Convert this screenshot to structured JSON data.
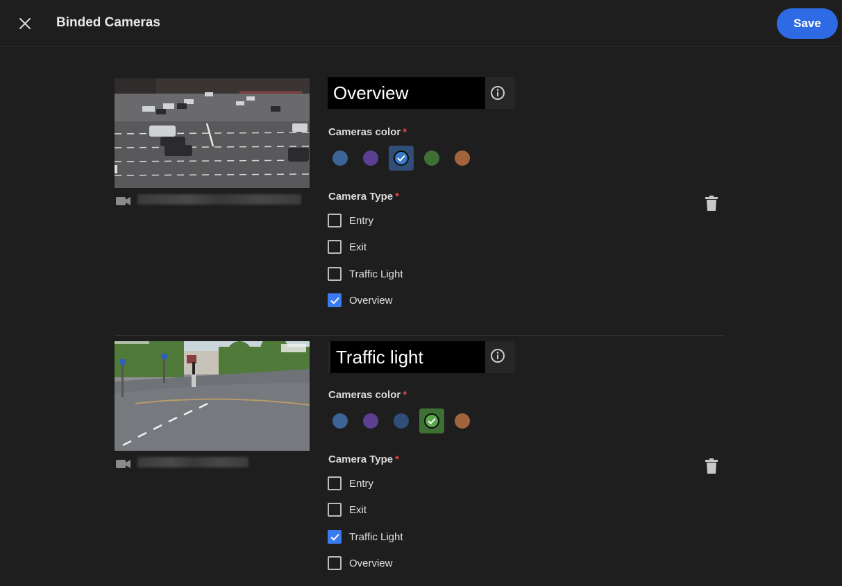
{
  "header": {
    "title": "Binded Cameras",
    "save_label": "Save"
  },
  "cameras": [
    {
      "name": "Overview",
      "color_label": "Cameras color",
      "type_label": "Camera Type",
      "required_mark": "*",
      "colors": [
        "#3d6496",
        "#5b3f91",
        "#3b7bc9",
        "#3f6e37",
        "#a4643b"
      ],
      "selected_color_index": 2,
      "types": [
        {
          "label": "Entry",
          "checked": false
        },
        {
          "label": "Exit",
          "checked": false
        },
        {
          "label": "Traffic Light",
          "checked": false
        },
        {
          "label": "Overview",
          "checked": true
        }
      ]
    },
    {
      "name": "Traffic light",
      "color_label": "Cameras color",
      "type_label": "Camera Type",
      "required_mark": "*",
      "colors": [
        "#3d6496",
        "#5b3f91",
        "#2f4f78",
        "#5aa84a",
        "#a4643b"
      ],
      "selected_color_index": 3,
      "types": [
        {
          "label": "Entry",
          "checked": false
        },
        {
          "label": "Exit",
          "checked": false
        },
        {
          "label": "Traffic Light",
          "checked": true
        },
        {
          "label": "Overview",
          "checked": false
        }
      ]
    }
  ],
  "icons": {
    "close": "close-icon",
    "info": "info-icon",
    "camera": "video-camera-icon",
    "delete": "trash-icon",
    "check": "check-icon"
  }
}
